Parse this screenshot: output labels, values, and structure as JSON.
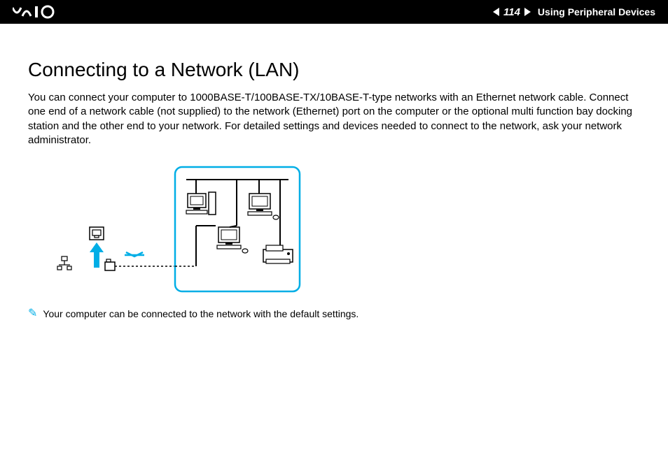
{
  "header": {
    "logo_text": "VAIO",
    "page_number": "114",
    "section_label": "Using Peripheral Devices"
  },
  "main": {
    "title": "Connecting to a Network (LAN)",
    "body_text": "You can connect your computer to 1000BASE-T/100BASE-TX/10BASE-T-type networks with an Ethernet network cable. Connect one end of a network cable (not supplied) to the network (Ethernet) port on the computer or the optional multi function bay docking station and the other end to your network. For detailed settings and devices needed to connect to the network, ask your network administrator."
  },
  "note": {
    "text": "Your computer can be connected to the network with the default settings."
  }
}
